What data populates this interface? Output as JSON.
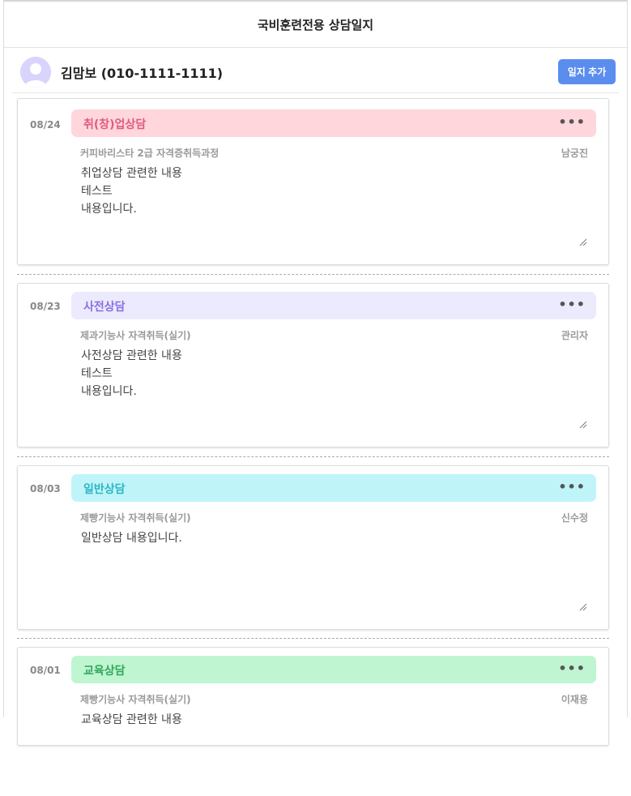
{
  "header": {
    "title": "국비훈련전용 상담일지"
  },
  "user": {
    "name": "김맘보 (010-1111-1111)",
    "add_button": "일지 추가"
  },
  "logs": [
    {
      "date": "08/24",
      "type": "취(창)업상담",
      "type_color": "#e05a82",
      "bar_color": "#fed6dc",
      "course": "커피바리스타 2급 자격증취득과정",
      "counselor": "남궁진",
      "content": "취업상담 관련한 내용\n테스트\n내용입니다."
    },
    {
      "date": "08/23",
      "type": "사전상담",
      "type_color": "#8a6ee6",
      "bar_color": "#ecebfd",
      "course": "제과기능사 자격취득(실기)",
      "counselor": "관리자",
      "content": "사전상담 관련한 내용\n테스트\n내용입니다."
    },
    {
      "date": "08/03",
      "type": "일반상담",
      "type_color": "#2cb5c4",
      "bar_color": "#bff5f8",
      "course": "제빵기능사 자격취득(실기)",
      "counselor": "신수정",
      "content": "일반상담 내용입니다."
    },
    {
      "date": "08/01",
      "type": "교육상담",
      "type_color": "#2fa85a",
      "bar_color": "#bff5d1",
      "course": "제빵기능사 자격취득(실기)",
      "counselor": "이재용",
      "content": "교육상담 관련한 내용"
    }
  ],
  "more_icon": "ellipsis-icon"
}
